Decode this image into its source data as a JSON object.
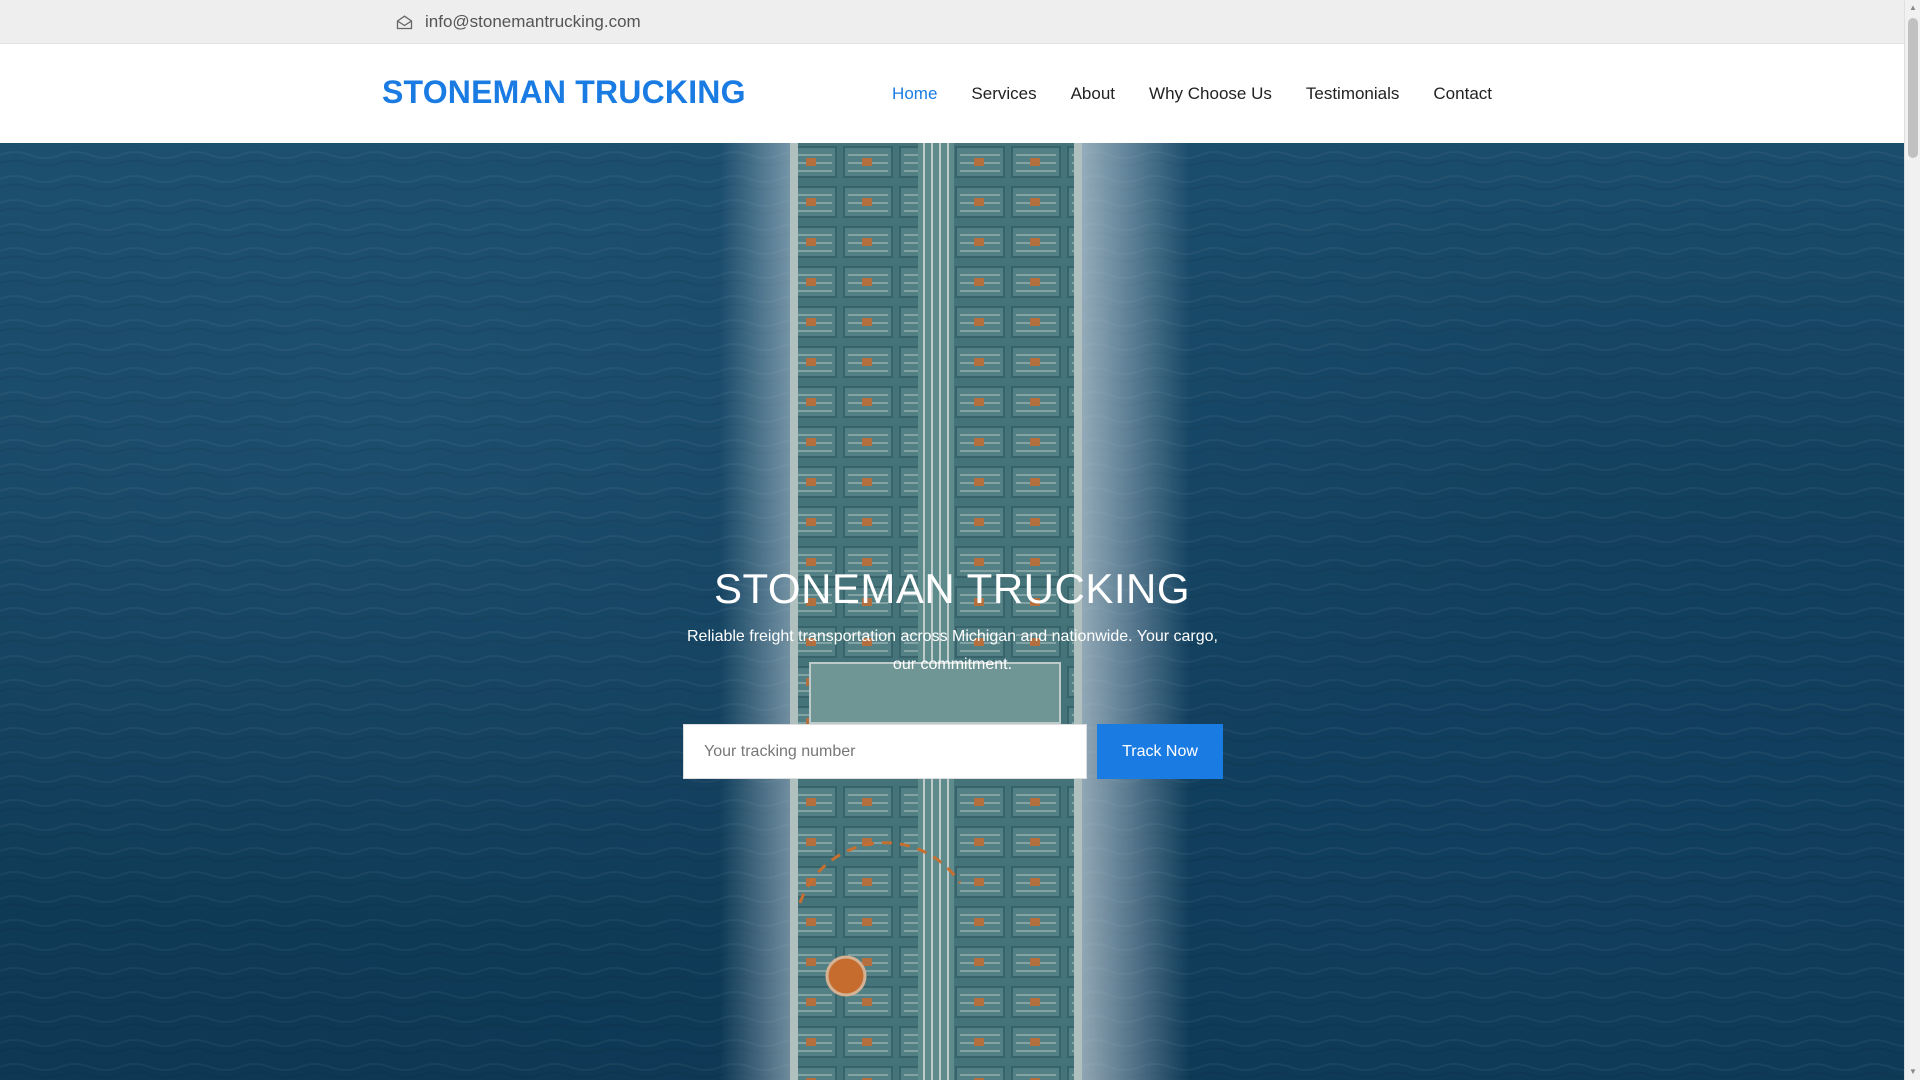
{
  "topbar": {
    "email": "info@stonemantrucking.com",
    "email_icon": "envelope-open-icon"
  },
  "header": {
    "logo": "STONEMAN TRUCKING",
    "nav": [
      {
        "label": "Home",
        "active": true
      },
      {
        "label": "Services",
        "active": false
      },
      {
        "label": "About",
        "active": false
      },
      {
        "label": "Why Choose Us",
        "active": false
      },
      {
        "label": "Testimonials",
        "active": false
      },
      {
        "label": "Contact",
        "active": false
      }
    ]
  },
  "hero": {
    "title": "STONEMAN TRUCKING",
    "subtitle": "Reliable freight transportation across Michigan and nationwide. Your cargo, our commitment.",
    "background": "aerial-ship-ocean-image",
    "tracking": {
      "placeholder": "Your tracking number",
      "value": "",
      "button_label": "Track Now"
    }
  },
  "colors": {
    "accent": "#1a7ce3",
    "topbar_bg": "#eeeeee",
    "ocean": "#134460"
  }
}
